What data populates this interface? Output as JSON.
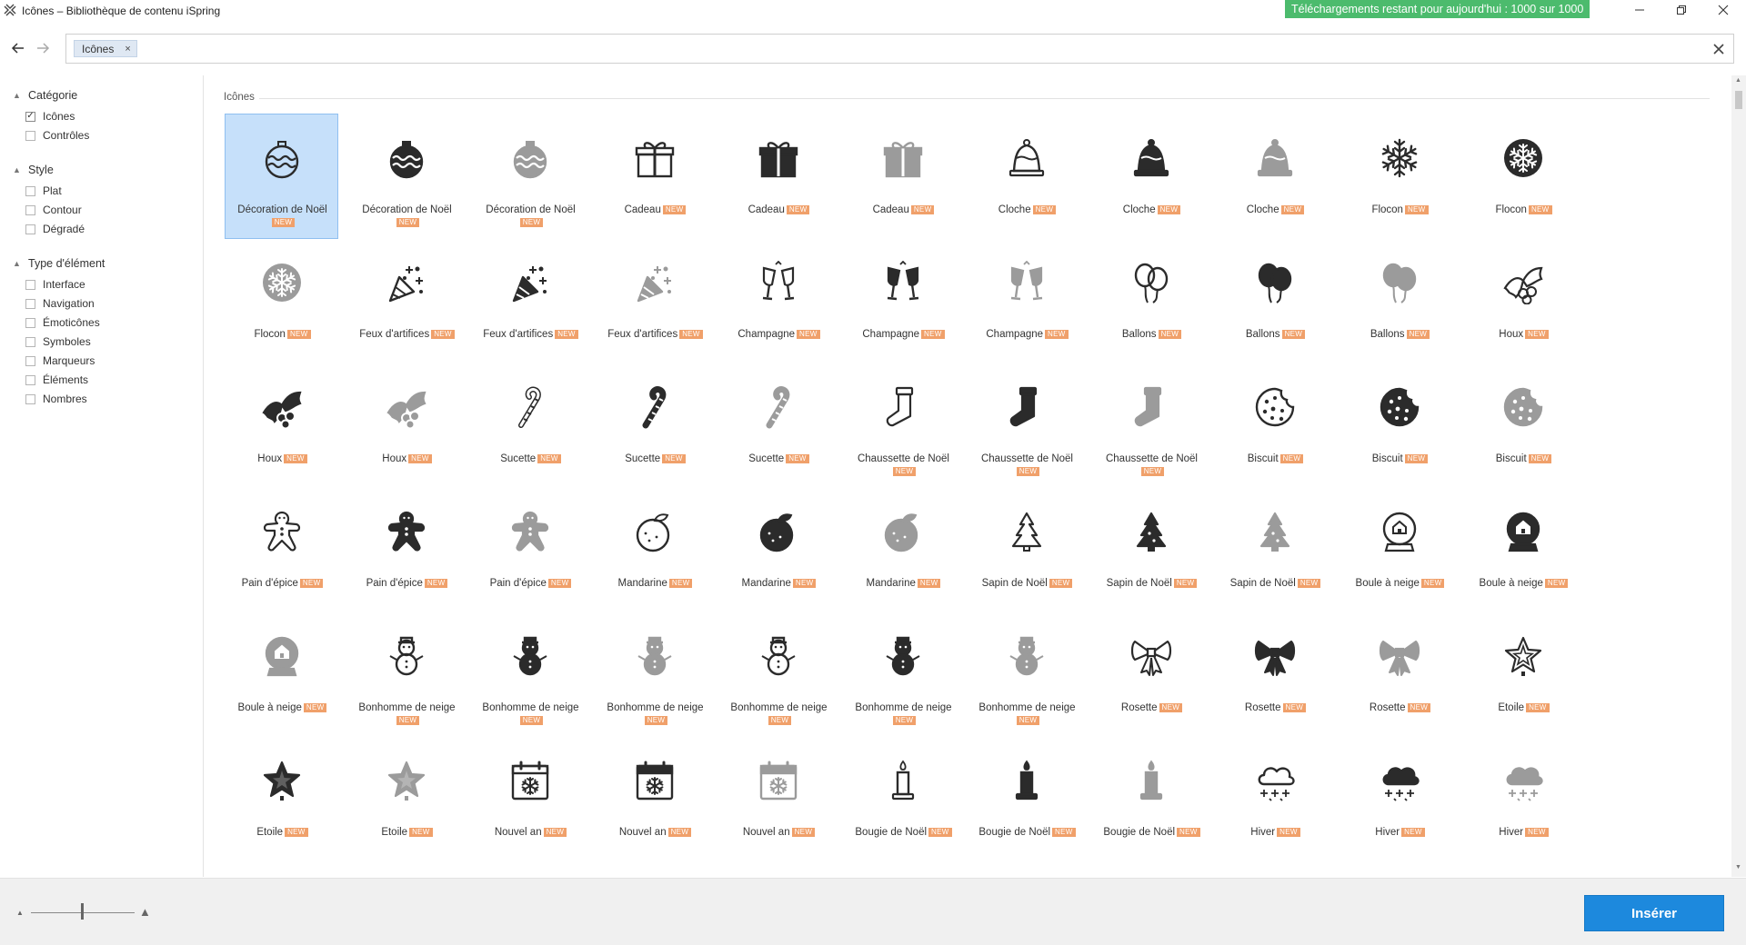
{
  "window": {
    "title": "Icônes – Bibliothèque de contenu iSpring",
    "quota_text": "Téléchargements restant pour aujourd'hui : 1000 sur 1000"
  },
  "search": {
    "tag_label": "Icônes",
    "value": "",
    "tag_remove": "×"
  },
  "sidebar": {
    "sections": [
      {
        "title": "Catégorie",
        "items": [
          {
            "label": "Icônes",
            "checked": true
          },
          {
            "label": "Contrôles",
            "checked": false
          }
        ]
      },
      {
        "title": "Style",
        "items": [
          {
            "label": "Plat",
            "checked": false
          },
          {
            "label": "Contour",
            "checked": false
          },
          {
            "label": "Dégradé",
            "checked": false
          }
        ]
      },
      {
        "title": "Type d'élément",
        "items": [
          {
            "label": "Interface",
            "checked": false
          },
          {
            "label": "Navigation",
            "checked": false
          },
          {
            "label": "Émoticônes",
            "checked": false
          },
          {
            "label": "Symboles",
            "checked": false
          },
          {
            "label": "Marqueurs",
            "checked": false
          },
          {
            "label": "Éléments",
            "checked": false
          },
          {
            "label": "Nombres",
            "checked": false
          }
        ]
      }
    ]
  },
  "main": {
    "section_label": "Icônes",
    "badge": "NEW",
    "selected_index": 0,
    "icons": [
      {
        "label": "Décoration de Noël",
        "shape": "ornament",
        "style": "outline"
      },
      {
        "label": "Décoration de Noël",
        "shape": "ornament",
        "style": "solid"
      },
      {
        "label": "Décoration de Noël",
        "shape": "ornament",
        "style": "gray"
      },
      {
        "label": "Cadeau",
        "shape": "gift",
        "style": "outline"
      },
      {
        "label": "Cadeau",
        "shape": "gift",
        "style": "solid"
      },
      {
        "label": "Cadeau",
        "shape": "gift",
        "style": "gray"
      },
      {
        "label": "Cloche",
        "shape": "bell",
        "style": "outline"
      },
      {
        "label": "Cloche",
        "shape": "bell",
        "style": "solid"
      },
      {
        "label": "Cloche",
        "shape": "bell",
        "style": "gray"
      },
      {
        "label": "Flocon",
        "shape": "snowflake",
        "style": "outline"
      },
      {
        "label": "Flocon",
        "shape": "snowflake-circle",
        "style": "solid"
      },
      {
        "label": "Flocon",
        "shape": "snowflake-circle",
        "style": "gray"
      },
      {
        "label": "Feux d'artifices",
        "shape": "party",
        "style": "outline"
      },
      {
        "label": "Feux d'artifices",
        "shape": "party",
        "style": "solid"
      },
      {
        "label": "Feux d'artifices",
        "shape": "party",
        "style": "gray"
      },
      {
        "label": "Champagne",
        "shape": "glasses",
        "style": "outline"
      },
      {
        "label": "Champagne",
        "shape": "glasses",
        "style": "solid"
      },
      {
        "label": "Champagne",
        "shape": "glasses",
        "style": "gray"
      },
      {
        "label": "Ballons",
        "shape": "balloons",
        "style": "outline"
      },
      {
        "label": "Ballons",
        "shape": "balloons",
        "style": "solid"
      },
      {
        "label": "Ballons",
        "shape": "balloons",
        "style": "gray"
      },
      {
        "label": "Houx",
        "shape": "holly",
        "style": "outline"
      },
      {
        "label": "Houx",
        "shape": "holly",
        "style": "solid"
      },
      {
        "label": "Houx",
        "shape": "holly",
        "style": "gray"
      },
      {
        "label": "Sucette",
        "shape": "cane",
        "style": "outline"
      },
      {
        "label": "Sucette",
        "shape": "cane",
        "style": "solid"
      },
      {
        "label": "Sucette",
        "shape": "cane",
        "style": "gray"
      },
      {
        "label": "Chaussette de Noël",
        "shape": "stocking",
        "style": "outline"
      },
      {
        "label": "Chaussette de Noël",
        "shape": "stocking",
        "style": "solid"
      },
      {
        "label": "Chaussette de Noël",
        "shape": "stocking",
        "style": "gray"
      },
      {
        "label": "Biscuit",
        "shape": "cookie",
        "style": "outline"
      },
      {
        "label": "Biscuit",
        "shape": "cookie",
        "style": "solid"
      },
      {
        "label": "Biscuit",
        "shape": "cookie",
        "style": "gray"
      },
      {
        "label": "Pain d'épice",
        "shape": "gingerbread",
        "style": "outline"
      },
      {
        "label": "Pain d'épice",
        "shape": "gingerbread",
        "style": "solid"
      },
      {
        "label": "Pain d'épice",
        "shape": "gingerbread",
        "style": "gray"
      },
      {
        "label": "Mandarine",
        "shape": "mandarin",
        "style": "outline"
      },
      {
        "label": "Mandarine",
        "shape": "mandarin",
        "style": "solid"
      },
      {
        "label": "Mandarine",
        "shape": "mandarin",
        "style": "gray"
      },
      {
        "label": "Sapin de Noël",
        "shape": "tree",
        "style": "outline"
      },
      {
        "label": "Sapin de Noël",
        "shape": "tree",
        "style": "solid"
      },
      {
        "label": "Sapin de Noël",
        "shape": "tree",
        "style": "gray"
      },
      {
        "label": "Boule à neige",
        "shape": "globe",
        "style": "outline"
      },
      {
        "label": "Boule à neige",
        "shape": "globe",
        "style": "solid"
      },
      {
        "label": "Boule à neige",
        "shape": "globe",
        "style": "gray"
      },
      {
        "label": "Bonhomme de neige",
        "shape": "snowman",
        "style": "outline"
      },
      {
        "label": "Bonhomme de neige",
        "shape": "snowman",
        "style": "solid"
      },
      {
        "label": "Bonhomme de neige",
        "shape": "snowman",
        "style": "gray"
      },
      {
        "label": "Bonhomme de neige",
        "shape": "snowman",
        "style": "outline"
      },
      {
        "label": "Bonhomme de neige",
        "shape": "snowman",
        "style": "solid"
      },
      {
        "label": "Bonhomme de neige",
        "shape": "snowman",
        "style": "gray"
      },
      {
        "label": "Rosette",
        "shape": "bow",
        "style": "outline"
      },
      {
        "label": "Rosette",
        "shape": "bow",
        "style": "solid"
      },
      {
        "label": "Rosette",
        "shape": "bow",
        "style": "gray"
      },
      {
        "label": "Etoile",
        "shape": "star",
        "style": "outline"
      },
      {
        "label": "Etoile",
        "shape": "star",
        "style": "solid"
      },
      {
        "label": "Etoile",
        "shape": "star",
        "style": "gray"
      },
      {
        "label": "Nouvel an",
        "shape": "calendar",
        "style": "outline"
      },
      {
        "label": "Nouvel an",
        "shape": "calendar",
        "style": "solid"
      },
      {
        "label": "Nouvel an",
        "shape": "calendar",
        "style": "gray"
      },
      {
        "label": "Bougie de Noël",
        "shape": "candle",
        "style": "outline"
      },
      {
        "label": "Bougie de Noël",
        "shape": "candle",
        "style": "solid"
      },
      {
        "label": "Bougie de Noël",
        "shape": "candle",
        "style": "gray"
      },
      {
        "label": "Hiver",
        "shape": "cloud",
        "style": "outline"
      },
      {
        "label": "Hiver",
        "shape": "cloud",
        "style": "solid"
      },
      {
        "label": "Hiver",
        "shape": "cloud",
        "style": "gray"
      }
    ]
  },
  "footer": {
    "insert_label": "Insérer"
  },
  "colors": {
    "accent": "#1d89dd",
    "quota_bg": "#4cbb6d",
    "badge_bg": "#f0a06a",
    "selected_bg": "#c6e0fa",
    "icon_dark": "#2b2b2b",
    "icon_gray": "#9b9b9b"
  }
}
